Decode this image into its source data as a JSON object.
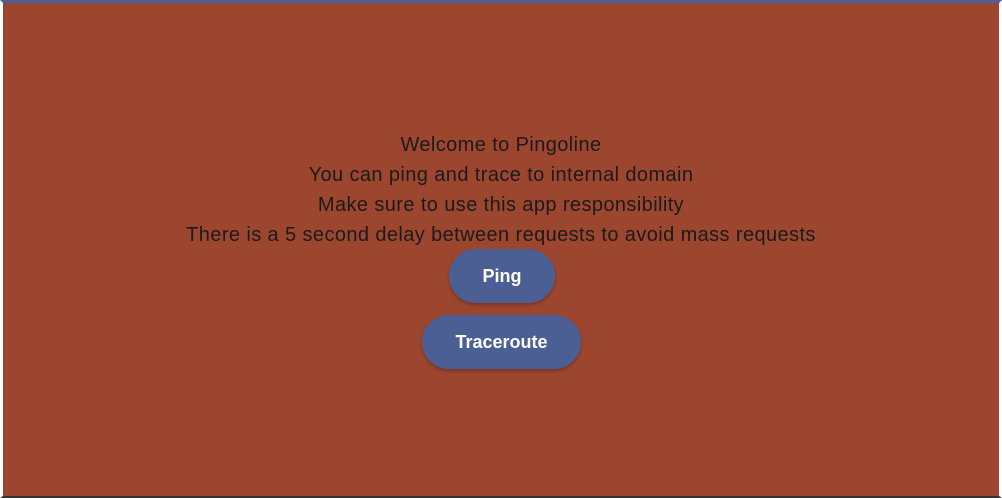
{
  "welcome": {
    "line1": "Welcome to Pingoline",
    "line2": "You can ping and trace to internal domain",
    "line3": "Make sure to use this app responsibility",
    "line4": "There is a 5 second delay between requests to avoid mass requests"
  },
  "buttons": {
    "ping_label": "Ping",
    "traceroute_label": "Traceroute"
  },
  "colors": {
    "background": "#9c462f",
    "accent": "#4c5f95",
    "button_text": "#ffffff",
    "body_text": "#1c1a1a"
  }
}
